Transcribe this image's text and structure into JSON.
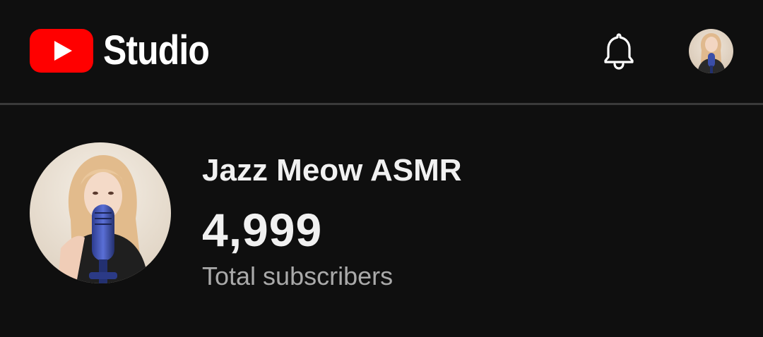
{
  "header": {
    "app_name": "Studio",
    "icons": [
      "youtube-logo",
      "bell-icon",
      "account-avatar"
    ],
    "brand_color": "#ff0000"
  },
  "channel": {
    "name": "Jazz Meow ASMR",
    "subscriber_count": "4,999",
    "subscriber_label": "Total subscribers"
  },
  "colors": {
    "background": "#0f0f0f",
    "divider": "#3a3a3a",
    "primary_text": "#f1f1f1",
    "secondary_text": "#aaaaaa"
  }
}
